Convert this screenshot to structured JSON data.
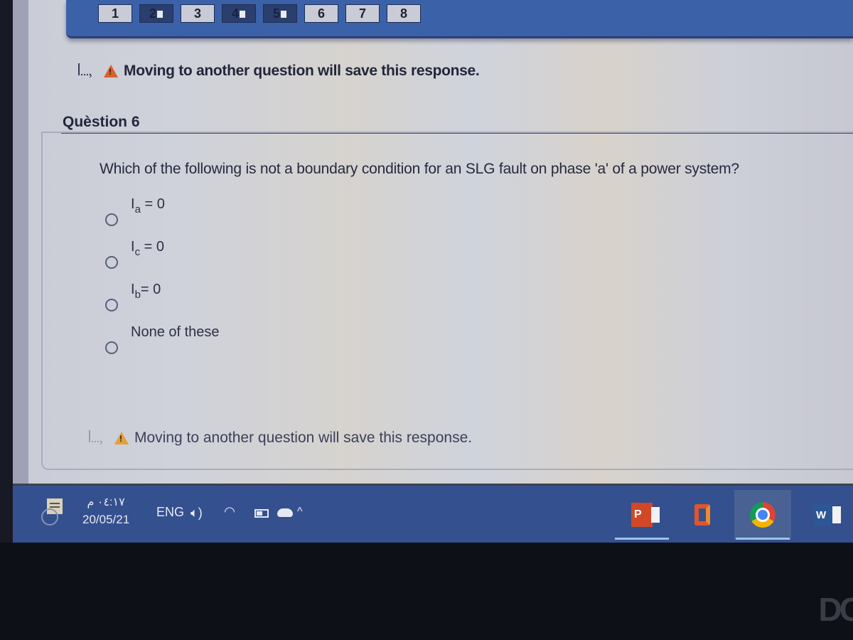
{
  "question_nav": {
    "buttons": [
      {
        "label": "1",
        "state": "unanswered"
      },
      {
        "label": "2",
        "state": "answered"
      },
      {
        "label": "3",
        "state": "unanswered"
      },
      {
        "label": "4",
        "state": "answered"
      },
      {
        "label": "5",
        "state": "answered"
      },
      {
        "label": "6",
        "state": "current"
      },
      {
        "label": "7",
        "state": "unanswered"
      },
      {
        "label": "8",
        "state": "unanswered"
      }
    ]
  },
  "notice": {
    "text": "Moving to another question will save this response."
  },
  "question": {
    "title": "Quèstion 6",
    "text": "Which of the following is not a boundary condition for an SLG fault on phase 'a' of a power system?",
    "options": [
      {
        "base": "I",
        "sub": "a",
        "rest": " = 0",
        "selected": false
      },
      {
        "base": "I",
        "sub": "c",
        "rest": " = 0",
        "selected": false
      },
      {
        "base": "I",
        "sub": "b",
        "rest": "= 0",
        "selected": false
      },
      {
        "base": "",
        "sub": "",
        "rest": "None of these",
        "selected": false
      }
    ]
  },
  "taskbar": {
    "time": "٠٤:١٧ م",
    "date": "20/05/21",
    "language": "ENG",
    "apps": [
      "PowerPoint",
      "Office",
      "Chrome",
      "Word"
    ],
    "ppt_letter": "P",
    "word_letter": "W"
  },
  "brand": "DC"
}
